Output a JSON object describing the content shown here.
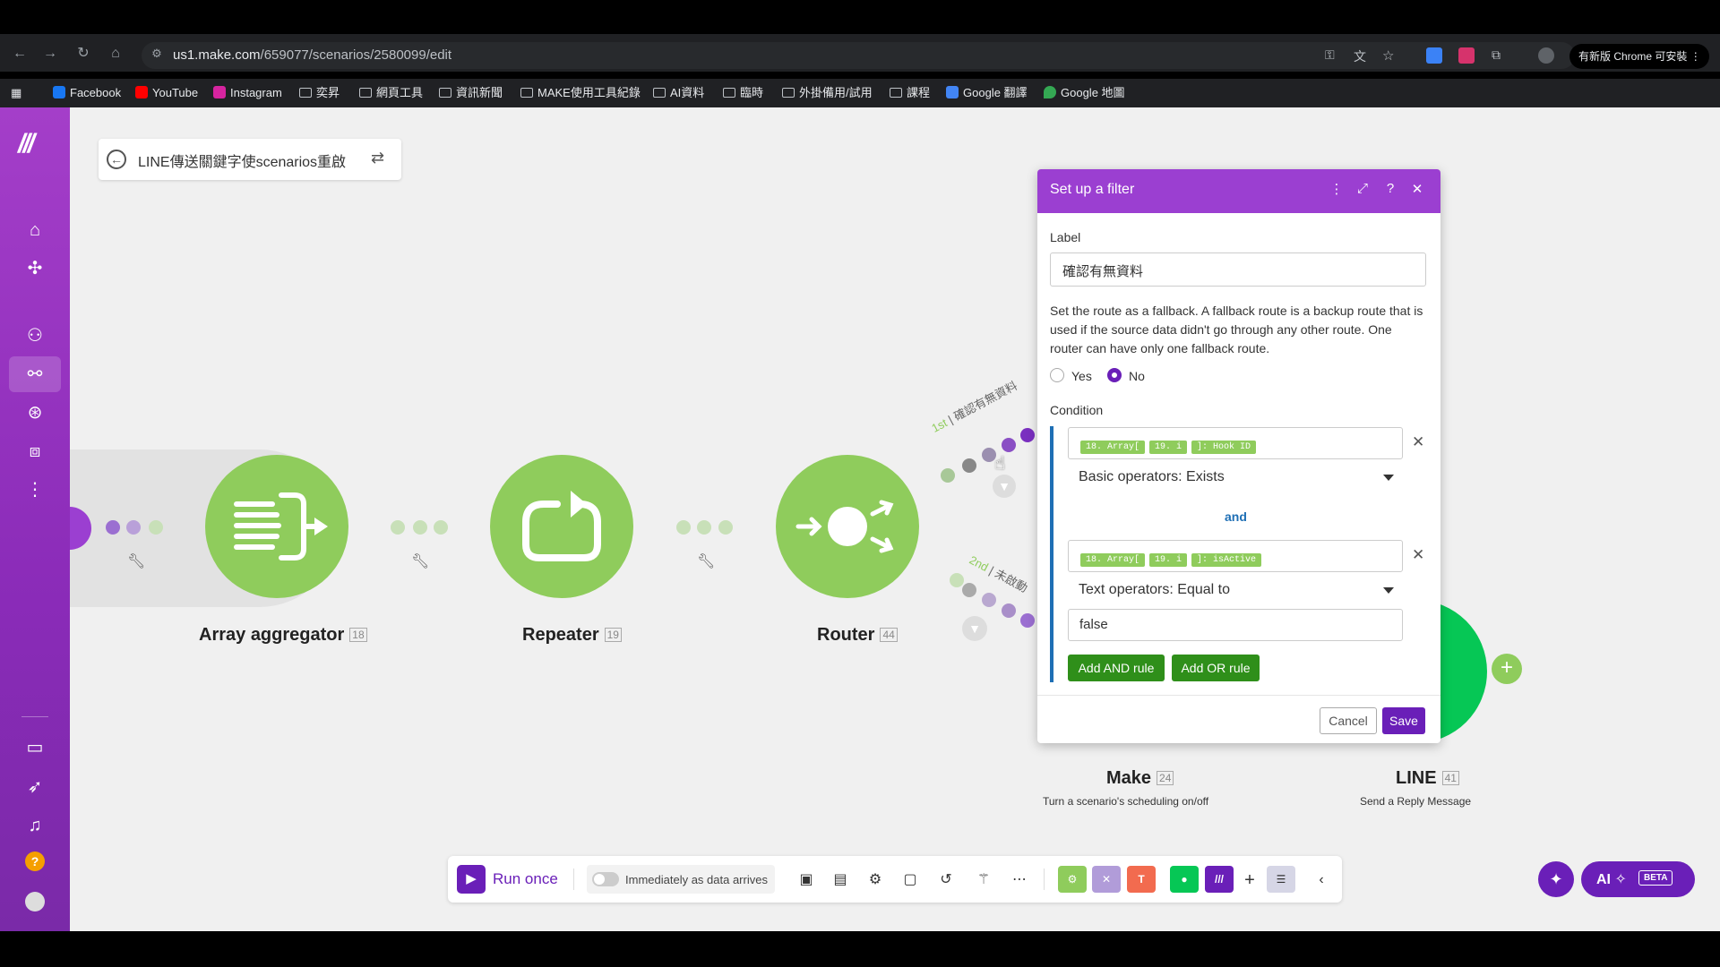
{
  "browser": {
    "url_host": "us1.make.com",
    "url_path": "/659077/scenarios/2580099/edit",
    "update_label": "有新版 Chrome 可安裝"
  },
  "bookmarks": [
    {
      "label": "Facebook",
      "icon": "facebook-icon"
    },
    {
      "label": "YouTube",
      "icon": "youtube-icon"
    },
    {
      "label": "Instagram",
      "icon": "instagram-icon"
    },
    {
      "label": "奕昇",
      "icon": "folder-icon"
    },
    {
      "label": "網頁工具",
      "icon": "folder-icon"
    },
    {
      "label": "資訊新聞",
      "icon": "folder-icon"
    },
    {
      "label": "MAKE使用工具紀錄",
      "icon": "folder-icon"
    },
    {
      "label": "AI資料",
      "icon": "folder-icon"
    },
    {
      "label": "臨時",
      "icon": "folder-icon"
    },
    {
      "label": "外掛備用/試用",
      "icon": "folder-icon"
    },
    {
      "label": "課程",
      "icon": "folder-icon"
    },
    {
      "label": "Google 翻譯",
      "icon": "google-translate-icon"
    },
    {
      "label": "Google 地圖",
      "icon": "google-maps-icon"
    }
  ],
  "scenario": {
    "title": "LINE傳送關鍵字使scenarios重啟"
  },
  "modules": [
    {
      "name": "Array aggregator",
      "id": "18"
    },
    {
      "name": "Repeater",
      "id": "19"
    },
    {
      "name": "Router",
      "id": "44"
    },
    {
      "name": "Make",
      "id": "24",
      "sub": "Turn a scenario's scheduling on/off"
    },
    {
      "name": "LINE",
      "id": "41",
      "sub": "Send a Reply Message"
    }
  ],
  "routes": {
    "route1_order": "1st",
    "route1_label": "確認有無資料",
    "route2_order": "2nd",
    "route2_label": "未啟動"
  },
  "dialog": {
    "title": "Set up a filter",
    "label_heading": "Label",
    "label_value": "確認有無資料",
    "fallback_text": "Set the route as a fallback. A fallback route is a backup route that is used if the source data didn't go through any other route. One router can have only one fallback route.",
    "radio_yes": "Yes",
    "radio_no": "No",
    "condition_heading": "Condition",
    "rule1_chips": [
      "18. Array[",
      "19. i",
      "]: Hook ID"
    ],
    "rule1_operator": "Basic operators: Exists",
    "and_label": "and",
    "rule2_chips": [
      "18. Array[",
      "19. i",
      "]: isActive"
    ],
    "rule2_operator": "Text operators: Equal to",
    "rule2_value": "false",
    "add_and": "Add AND rule",
    "add_or": "Add OR rule",
    "cancel": "Cancel",
    "save": "Save"
  },
  "toolbar": {
    "run_once": "Run once",
    "schedule": "Immediately as data arrives",
    "ai": "AI",
    "beta": "BETA"
  },
  "colors": {
    "accent": "#6a1fb8",
    "module_green": "#8fcc5c",
    "sidebar": "#9b3fd1"
  }
}
